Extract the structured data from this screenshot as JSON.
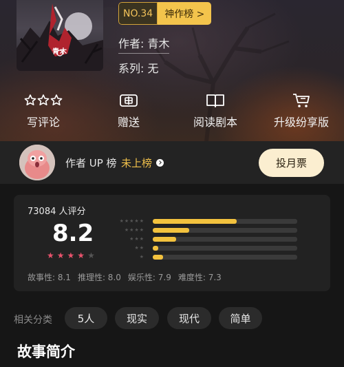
{
  "book": {
    "cover_author": "青木",
    "rank_number": "NO.34",
    "rank_list": "神作榜 >",
    "author_line": "作者: 青木",
    "series_line": "系列: 无"
  },
  "actions": [
    {
      "label": "写评论",
      "icon": "three-stars-icon"
    },
    {
      "label": "赠送",
      "icon": "gift-card-icon"
    },
    {
      "label": "阅读剧本",
      "icon": "open-book-icon"
    },
    {
      "label": "升级纷享版",
      "icon": "shopping-cart-icon"
    }
  ],
  "author_rank": {
    "label": "作者 UP 榜",
    "status": "未上榜",
    "vote_button": "投月票"
  },
  "rating": {
    "count": "73084 人评分",
    "score": "8.2",
    "stars_filled": 4,
    "stars_total": 5,
    "distribution": [
      {
        "stars": "★★★★★",
        "fraction": 0.58
      },
      {
        "stars": "★★★★",
        "fraction": 0.25
      },
      {
        "stars": "★★★",
        "fraction": 0.16
      },
      {
        "stars": "★★",
        "fraction": 0.04
      },
      {
        "stars": "★",
        "fraction": 0.07
      }
    ],
    "sub_scores": [
      "故事性: 8.1",
      "推理性: 8.0",
      "娱乐性: 7.9",
      "难度性: 7.3"
    ]
  },
  "related": {
    "label": "相关分类",
    "tags": [
      "5人",
      "现实",
      "现代",
      "简单"
    ]
  },
  "sections": {
    "intro_title": "故事简介"
  },
  "colors": {
    "accent_gold": "#f3c23e",
    "star_red": "#e8536c",
    "page_bg": "#161616"
  }
}
